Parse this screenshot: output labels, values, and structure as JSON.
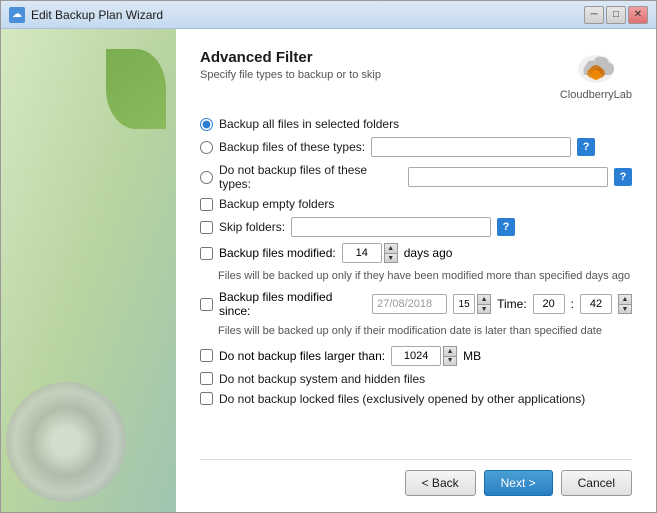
{
  "window": {
    "title": "Edit Backup Plan Wizard",
    "controls": [
      "minimize",
      "maximize",
      "close"
    ]
  },
  "header": {
    "title": "Advanced Filter",
    "subtitle": "Specify file types to backup or to skip",
    "logo_text": "CloudberryLab"
  },
  "filters": {
    "backup_all_label": "Backup all files in selected folders",
    "backup_types_label": "Backup files of these types:",
    "no_backup_types_label": "Do not backup files of these types:",
    "backup_empty_label": "Backup empty folders",
    "skip_folders_label": "Skip folders:",
    "backup_modified_label": "Backup files modified:",
    "backup_modified_days": "14",
    "backup_modified_suffix": "days ago",
    "hint_modified": "Files will be backed up only if they have been modified more than specified days ago",
    "backup_modified_since_label": "Backup files modified since:",
    "modified_since_date": "27/08/2018",
    "modified_since_time_label": "Time:",
    "modified_since_hour": "20",
    "modified_since_minute": "42",
    "hint_modified_since": "Files will be backed up only if their modification date is later than specified date",
    "no_backup_larger_label": "Do not backup files larger than:",
    "larger_than_value": "1024",
    "larger_than_unit": "MB",
    "no_system_hidden_label": "Do not backup system and hidden files",
    "no_locked_label": "Do not backup locked files (exclusively opened by other applications)"
  },
  "footer": {
    "back_label": "< Back",
    "next_label": "Next >",
    "cancel_label": "Cancel"
  }
}
